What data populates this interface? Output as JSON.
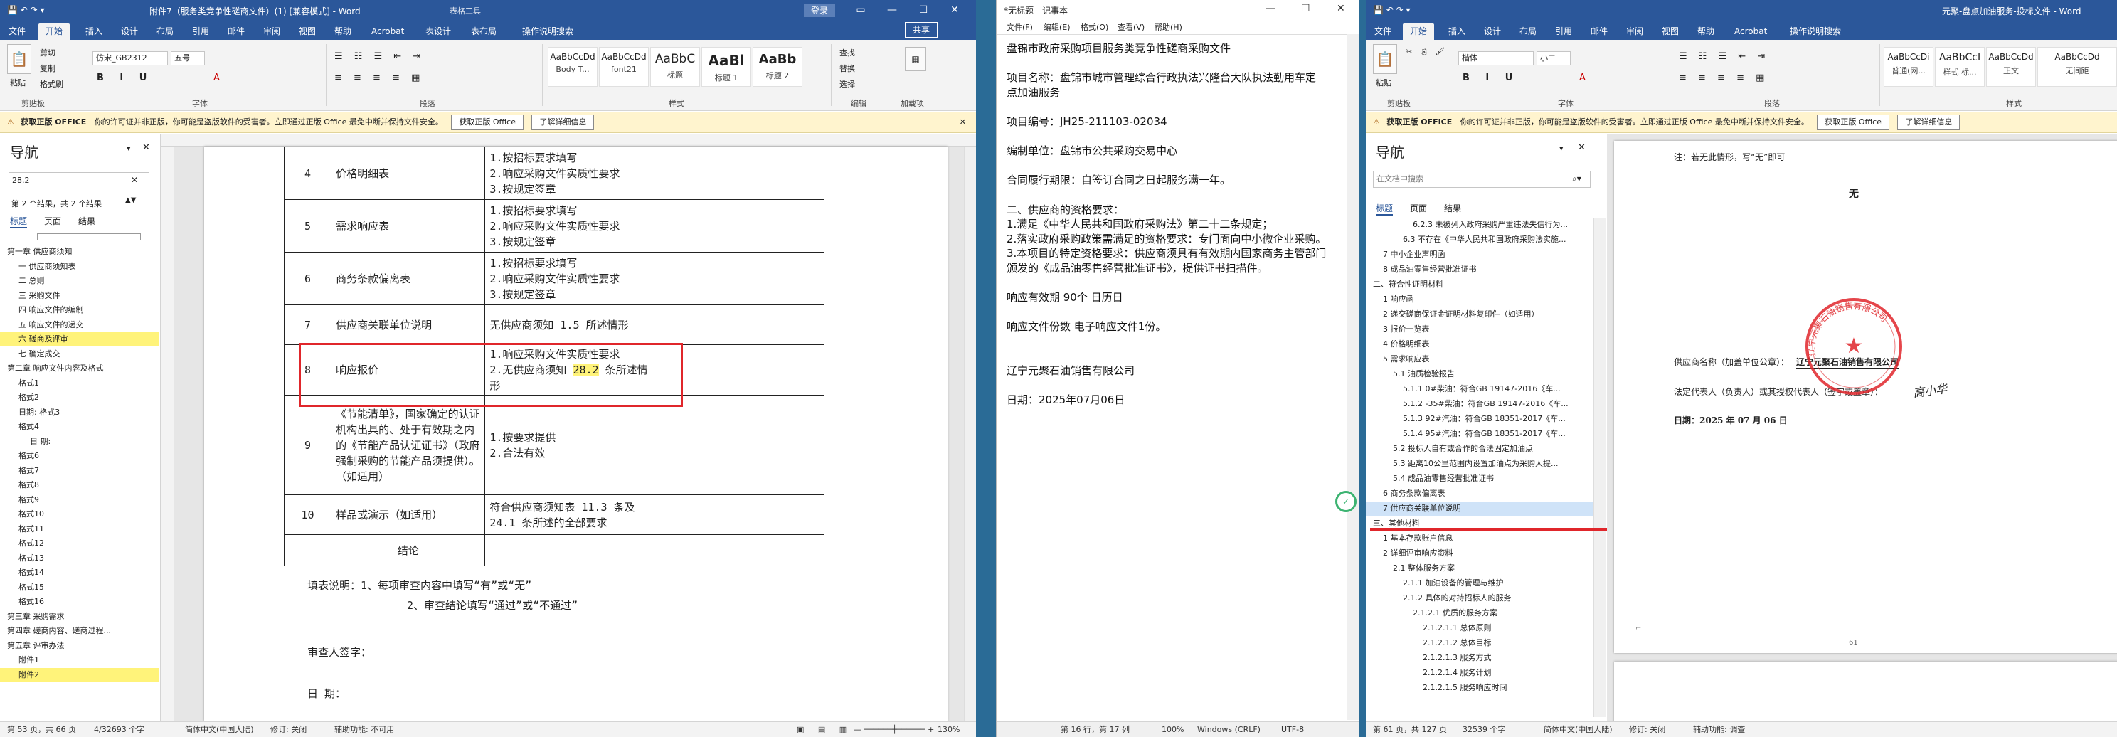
{
  "w1": {
    "title": "附件7（服务类竞争性磋商文件）(1) [兼容模式] - Word",
    "table_tools": "表格工具",
    "login": "登录",
    "share": "共享",
    "tabs": [
      "文件",
      "开始",
      "插入",
      "设计",
      "布局",
      "引用",
      "邮件",
      "审阅",
      "视图",
      "帮助",
      "Acrobat",
      "表设计",
      "表布局",
      "操作说明搜索"
    ],
    "clipboard": {
      "paste": "粘贴",
      "cut": "剪切",
      "copy": "复制",
      "painter": "格式刷",
      "label": "剪贴板"
    },
    "font": {
      "name": "仿宋_GB2312",
      "size": "五号",
      "label": "字体"
    },
    "paragraph_label": "段落",
    "styles": [
      {
        "preview": "AaBbCcDd",
        "name": "Body T..."
      },
      {
        "preview": "AaBbCcDd",
        "name": "font21"
      },
      {
        "preview": "AaBbC",
        "name": "标题"
      },
      {
        "preview": "AaBl",
        "name": "标题 1"
      },
      {
        "preview": "AaBb",
        "name": "标题 2"
      }
    ],
    "styles_label": "样式",
    "editing": {
      "find": "查找",
      "replace": "替换",
      "select": "选择",
      "label": "编辑"
    },
    "addins": {
      "name": "加载项",
      "label": "加载项"
    },
    "infobar": {
      "title": "获取正版 OFFICE",
      "text": "你的许可证并非正版，你可能是盗版软件的受害者。立即通过正版 Office 最免中断并保持文件安全。",
      "btn1": "获取正版 Office",
      "btn2": "了解详细信息"
    },
    "nav": {
      "title": "导航",
      "search": "28.2",
      "result": "第 2 个结果，共 2 个结果",
      "tabs": [
        "标题",
        "页面",
        "结果"
      ],
      "items": [
        "第一章 供应商须知",
        "一 供应商须知表",
        "二 总则",
        "三 采购文件",
        "四 响应文件的编制",
        "五 响应文件的递交",
        "六 磋商及评审",
        "七 确定成交",
        "第二章 响应文件内容及格式",
        "格式1",
        "格式2",
        "日期:    格式3",
        "格式4",
        "日    期:",
        "格式6",
        "格式7",
        "格式8",
        "格式9",
        "格式10",
        "格式11",
        "格式12",
        "格式13",
        "格式14",
        "格式15",
        "格式16",
        "第三章 采购需求",
        "第四章 磋商内容、磋商过程...",
        "第五章 评审办法",
        "附件1",
        "附件2"
      ]
    },
    "table_rows": [
      {
        "no": "4",
        "item": "价格明细表",
        "req": [
          "1.按招标要求填写",
          "2.响应采购文件实质性要求",
          "3.按规定签章"
        ]
      },
      {
        "no": "5",
        "item": "需求响应表",
        "req": [
          "1.按招标要求填写",
          "2.响应采购文件实质性要求",
          "3.按规定签章"
        ]
      },
      {
        "no": "6",
        "item": "商务条款偏离表",
        "req": [
          "1.按招标要求填写",
          "2.响应采购文件实质性要求",
          "3.按规定签章"
        ]
      },
      {
        "no": "7",
        "item": "供应商关联单位说明",
        "req": [
          "无供应商须知 1.5 所述情形"
        ]
      },
      {
        "no": "8",
        "item": "响应报价",
        "req": [
          "1.响应采购文件实质性要求",
          "2.无供应商须知 28.2 条所述情形"
        ]
      },
      {
        "no": "9",
        "item": "《节能清单》，国家确定的认证机构出具的、处于有效期之内的《节能产品认证证书》（政府强制采购的节能产品须提供）。（如适用）",
        "req": [
          "1.按要求提供",
          "2.合法有效"
        ]
      },
      {
        "no": "10",
        "item": "样品或演示（如适用）",
        "req": [
          "符合供应商须知表 11.3 条及 24.1 条所述的全部要求"
        ]
      },
      {
        "no": "",
        "item": "结论",
        "req": [
          ""
        ]
      }
    ],
    "note1": "填表说明：1、每项审查内容中填写“有”或“无”",
    "note2": "2、审查结论填写“通过”或“不通过”",
    "reviewer": "审查人签字：",
    "date_label": "日      期：",
    "status": {
      "page": "第 53 页，共 66 页",
      "words": "4/32693 个字",
      "lang": "简体中文(中国大陆)",
      "track": "修订: 关闭",
      "access": "辅助功能: 不可用",
      "zoom": "130%"
    }
  },
  "w2": {
    "title": "*无标题 - 记事本",
    "menu": [
      "文件(F)",
      "编辑(E)",
      "格式(O)",
      "查看(V)",
      "帮助(H)"
    ],
    "lines": [
      "盘锦市政府采购项目服务类竞争性磋商采购文件",
      "",
      "项目名称：盘锦市城市管理综合行政执法兴隆台大队执法勤用车定",
      "点加油服务",
      "",
      "项目编号：JH25-211103-02034",
      "",
      "编制单位：盘锦市公共采购交易中心",
      "",
      "合同履行期限：自签订合同之日起服务满一年。",
      "",
      "二、供应商的资格要求：",
      "1.满足《中华人民共和国政府采购法》第二十二条规定；",
      "2.落实政府采购政策需满足的资格要求：专门面向中小微企业采购。",
      "3.本项目的特定资格要求：供应商须具有有效期内国家商务主管部门",
      "颁发的《成品油零售经营批准证书》，提供证书扫描件。",
      "",
      "响应有效期              90个  日历日",
      "",
      "响应文件份数          电子响应文件1份。",
      "",
      "",
      "辽宁元聚石油销售有限公司",
      "",
      "日期：2025年07月06日"
    ],
    "status": {
      "pos": "第 16 行，第 17 列",
      "zoom": "100%",
      "eol": "Windows (CRLF)",
      "enc": "UTF-8"
    }
  },
  "w3": {
    "title": "元聚-盘点加油服务-投标文件 - Word",
    "tabs": [
      "文件",
      "开始",
      "插入",
      "设计",
      "布局",
      "引用",
      "邮件",
      "审阅",
      "视图",
      "帮助",
      "Acrobat",
      "操作说明搜索"
    ],
    "clipboard": {
      "paste": "粘贴",
      "label": "剪贴板"
    },
    "font": {
      "name": "楷体",
      "size": "小二",
      "label": "字体"
    },
    "paragraph_label": "段落",
    "styles": [
      {
        "preview": "AaBbCcDi",
        "name": "普通(网..."
      },
      {
        "preview": "AaBbCcI",
        "name": "样式 标..."
      },
      {
        "preview": "AaBbCcDd",
        "name": "正文"
      },
      {
        "preview": "AaBbCcDd",
        "name": "无间距"
      }
    ],
    "styles_label": "样式",
    "infobar": {
      "title": "获取正版 OFFICE",
      "text": "你的许可证并非正版，你可能是盗版软件的受害者。立即通过正版 Office 最免中断并保持文件安全。",
      "btn1": "获取正版 Office",
      "btn2": "了解详细信息"
    },
    "nav": {
      "title": "导航",
      "search_placeholder": "在文档中搜索",
      "tabs": [
        "标题",
        "页面",
        "结果"
      ],
      "items": [
        "6.2.3 未被列入政府采购严重违法失信行为...",
        "6.3 不存在《中华人民共和国政府采购法实施...",
        "7 中小企业声明函",
        "8 成品油零售经营批准证书",
        "二、符合性证明材料",
        "1 响应函",
        "2 递交磋商保证金证明材料复印件（如适用）",
        "3 报价一览表",
        "4 价格明细表",
        "5 需求响应表",
        "5.1 油质检验报告",
        "5.1.1 0#柴油：符合GB 19147-2016《车...",
        "5.1.2 -35#柴油：符合GB 19147-2016《车...",
        "5.1.3 92#汽油：符合GB 18351-2017《车...",
        "5.1.4 95#汽油：符合GB 18351-2017《车...",
        "5.2 投标人自有或合作的合法固定加油点",
        "5.3 距离10公里范围内设置加油点为采购人提...",
        "5.4 成品油零售经营批准证书",
        "6 商务条款偏离表",
        "7 供应商关联单位说明",
        "三、其他材料",
        "1 基本存款账户信息",
        "2 详细评审响应资料",
        "2.1 整体服务方案",
        "2.1.1 加油设备的管理与维护",
        "2.1.2 具体的对持招标人的服务",
        "2.1.2.1 优质的服务方案",
        "2.1.2.1.1 总体原则",
        "2.1.2.1.2 总体目标",
        "2.1.2.1.3 服务方式",
        "2.1.2.1.4 服务计划",
        "2.1.2.1.5 服务响应时间"
      ]
    },
    "doc": {
      "top_note": "注：若无此情形，写“无”即可",
      "wu": "无",
      "supplier_label": "供应商名称（加盖单位公章）：",
      "supplier_value": "辽宁元聚石油销售有限公司",
      "legal_label": "法定代表人（负责人）或其授权代表人（签字或盖章）：",
      "date_line": "日期：2025 年 07 月 06 日",
      "stamp_text": "辽宁元聚石油销售有限公司",
      "signature": "高小华",
      "page_no": "61"
    },
    "status": {
      "page": "第 61 页，共 127 页",
      "words": "32539 个字",
      "lang": "简体中文(中国大陆)",
      "track": "修订: 关闭",
      "access": "辅助功能: 调查"
    }
  },
  "colors": {
    "word_blue": "#2b579a",
    "infobar": "#fff4ce",
    "highlight": "#fff37a",
    "red_box": "#e0262b",
    "stamp": "#e0262b"
  }
}
